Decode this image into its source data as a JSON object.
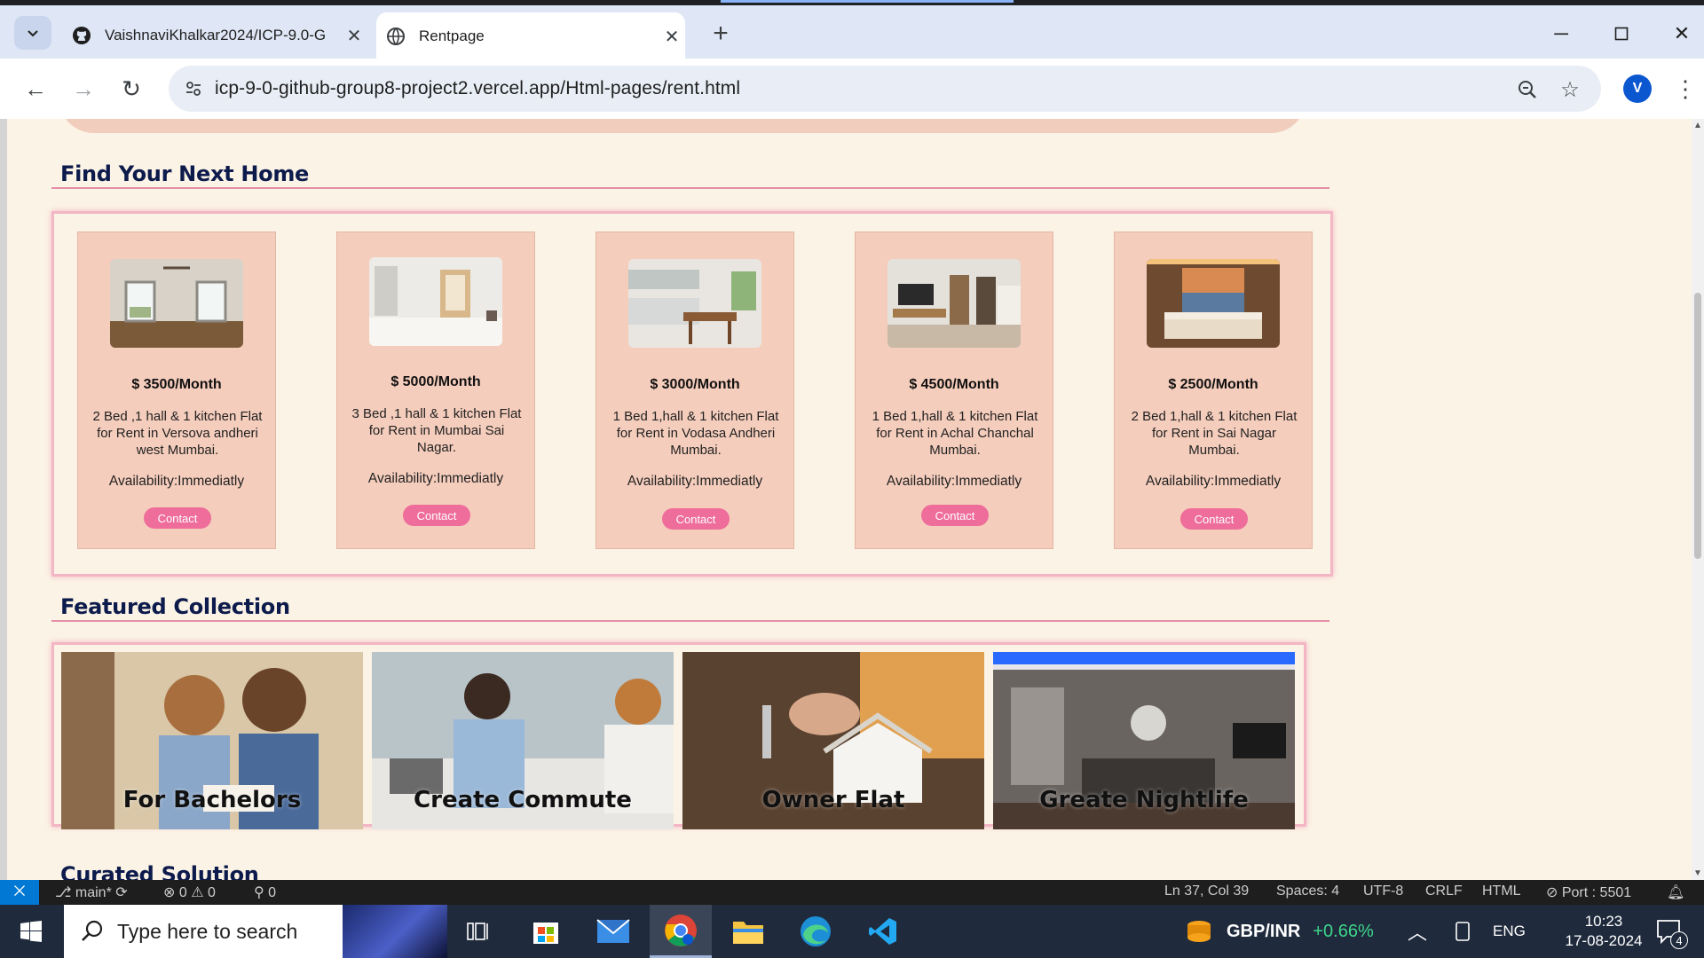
{
  "browser": {
    "tabs": [
      {
        "title": "VaishnaviKhalkar2024/ICP-9.0-G",
        "icon": "github-icon",
        "active": false
      },
      {
        "title": "Rentpage",
        "icon": "globe-icon",
        "active": true
      }
    ],
    "url": "icp-9-0-github-group8-project2.vercel.app/Html-pages/rent.html",
    "profile_initial": "V"
  },
  "page": {
    "section1_title": "Find Your Next Home",
    "listings": [
      {
        "price": "$ 3500/Month",
        "desc": "2 Bed ,1 hall & 1 kitchen Flat for Rent in Versova andheri west Mumbai.",
        "availability": "Availability:Immediatly",
        "contact": "Contact"
      },
      {
        "price": "$ 5000/Month",
        "desc": "3 Bed ,1 hall & 1 kitchen Flat for Rent in Mumbai Sai Nagar.",
        "availability": "Availability:Immediatly",
        "contact": "Contact"
      },
      {
        "price": "$ 3000/Month",
        "desc": "1 Bed 1,hall & 1 kitchen Flat for Rent in Vodasa Andheri Mumbai.",
        "availability": "Availability:Immediatly",
        "contact": "Contact"
      },
      {
        "price": "$ 4500/Month",
        "desc": "1 Bed 1,hall & 1 kitchen Flat for Rent in Achal Chanchal Mumbai.",
        "availability": "Availability:Immediatly",
        "contact": "Contact"
      },
      {
        "price": "$ 2500/Month",
        "desc": "2 Bed 1,hall & 1 kitchen Flat for Rent in Sai Nagar Mumbai.",
        "availability": "Availability:Immediatly",
        "contact": "Contact"
      }
    ],
    "section2_title": "Featured Collection",
    "collections": [
      {
        "label": "For Bachelors"
      },
      {
        "label": "Create Commute"
      },
      {
        "label": "Owner Flat"
      },
      {
        "label": "Greate Nightlife"
      }
    ],
    "section3_title": "Curated Solution"
  },
  "vscode_status": {
    "branch": "main*",
    "errors": "0",
    "warnings": "0",
    "ports": "0",
    "cursor": "Ln 37, Col 39",
    "spaces": "Spaces: 4",
    "encoding": "UTF-8",
    "eol": "CRLF",
    "language": "HTML",
    "port": "Port : 5501"
  },
  "taskbar": {
    "search_placeholder": "Type here to search",
    "ticker_label": "GBP/INR",
    "ticker_change": "+0.66%",
    "language": "ENG",
    "time": "10:23",
    "date": "17-08-2024",
    "notification_count": "4"
  },
  "colors": {
    "accent_pink": "#ee6d9a",
    "page_bg": "#fbf3e5",
    "card_bg": "#f5cdbc",
    "title_navy": "#0d1b4c",
    "ticker_green": "#3dd68c",
    "vscode_blue": "#0078d4"
  }
}
